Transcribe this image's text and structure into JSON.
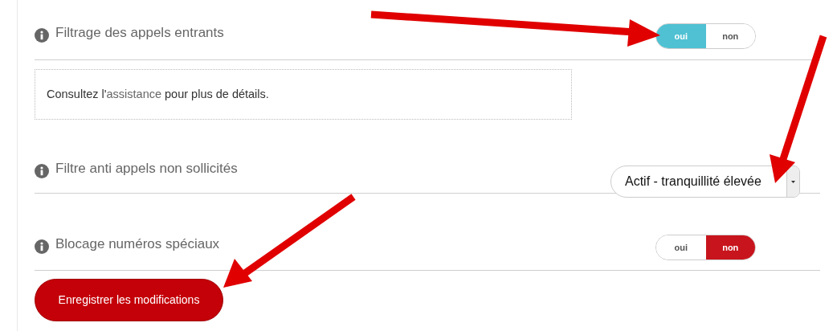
{
  "settings": [
    {
      "kind": "toggle",
      "label": "Filtrage des appels entrants",
      "options": [
        {
          "label": "oui",
          "selected": true
        },
        {
          "label": "non",
          "selected": false
        }
      ],
      "note": {
        "before": "Consultez l'",
        "link": "assistance",
        "after": " pour plus de détails."
      }
    },
    {
      "kind": "select",
      "label": "Filtre anti appels non sollicités",
      "value": "Actif - tranquillité élevée"
    },
    {
      "kind": "toggle",
      "label": "Blocage numéros spéciaux",
      "options": [
        {
          "label": "oui",
          "selected": false
        },
        {
          "label": "non",
          "selected": true
        }
      ]
    }
  ],
  "save_button": "Enregistrer les modifications"
}
